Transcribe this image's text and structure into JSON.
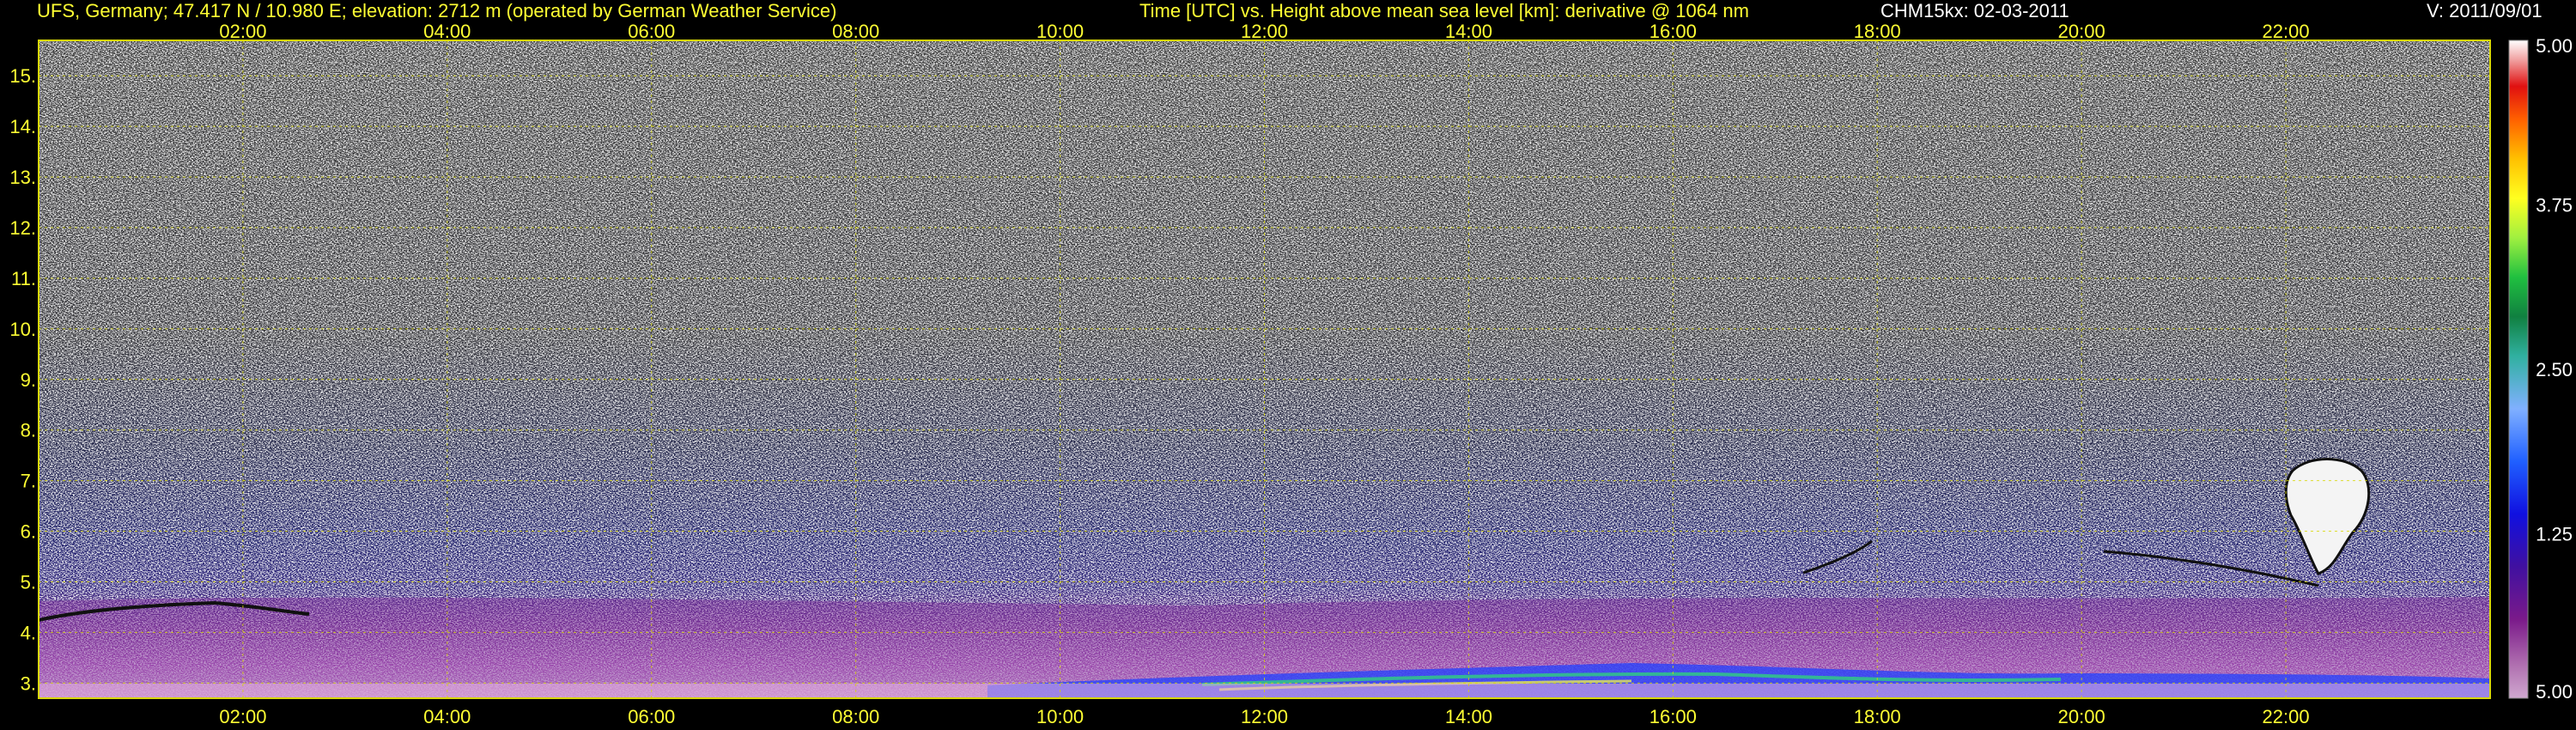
{
  "header": {
    "site": "UFS, Germany; 47.417 N / 10.980 E; elevation: 2712 m  (operated by German Weather Service)",
    "axes": "Time [UTC] vs. Height above mean sea level [km]: derivative @ 1064 nm",
    "instrument": "CHM15kx: 02-03-2011",
    "version": "V: 2011/09/01"
  },
  "colors": {
    "text": "#ffff33",
    "grid": "#d8d800",
    "background": "#000000"
  },
  "chart_data": {
    "type": "heatmap",
    "xlabel": "Time [UTC]",
    "ylabel": "Height above mean sea level [km]",
    "xlim": [
      "00:00",
      "24:00"
    ],
    "ylim": [
      2.7,
      15.7
    ],
    "x_ticks": [
      "02:00",
      "04:00",
      "06:00",
      "08:00",
      "10:00",
      "12:00",
      "14:00",
      "16:00",
      "18:00",
      "20:00",
      "22:00"
    ],
    "y_ticks": [
      "3.",
      "4.",
      "5.",
      "6.",
      "7.",
      "8.",
      "9.",
      "10.",
      "11.",
      "12.",
      "13.",
      "14.",
      "15."
    ],
    "grid": true,
    "colorbar": {
      "labels": [
        "5.00",
        "3.75",
        "2.50",
        "1.25",
        "5.00"
      ],
      "label_values": [
        5.0,
        3.75,
        2.5,
        1.25,
        5.0
      ]
    },
    "features": {
      "noise_region_km": [
        6.5,
        15.7
      ],
      "aerosol_layer_top_km": [
        4.2,
        5.2
      ],
      "cloud_time_range": [
        "22:30",
        "23:00"
      ],
      "cloud_height_km": [
        5.2,
        7.5
      ]
    }
  }
}
